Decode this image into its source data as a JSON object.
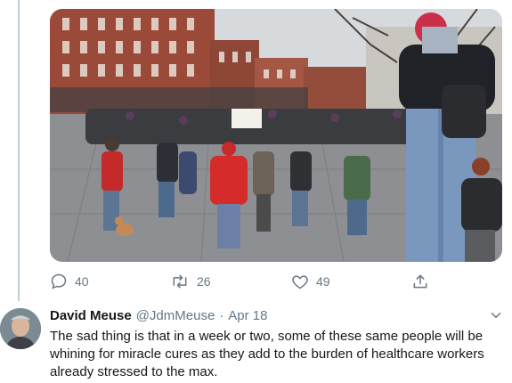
{
  "photo": {
    "description_icon": "protest-crowd-photo",
    "sign_text": "",
    "colors": {
      "brick": "#9b4a3a",
      "sky": "#d9dde0",
      "pavement": "#8d8f92"
    }
  },
  "actions": {
    "reply_count": "40",
    "retweet_count": "26",
    "like_count": "49",
    "icons": [
      "reply-icon",
      "retweet-icon",
      "like-icon",
      "share-icon"
    ]
  },
  "reply": {
    "name": "David Meuse",
    "handle": "@JdmMeuse",
    "separator": "·",
    "date": "Apr 18",
    "text": "The sad thing is that in a week or two, some of these same people will be whining for miracle cures as they add to the burden of healthcare workers already stressed to the max."
  },
  "colors": {
    "muted": "#657786",
    "text": "#14171a",
    "thread": "#c4cfd6"
  }
}
